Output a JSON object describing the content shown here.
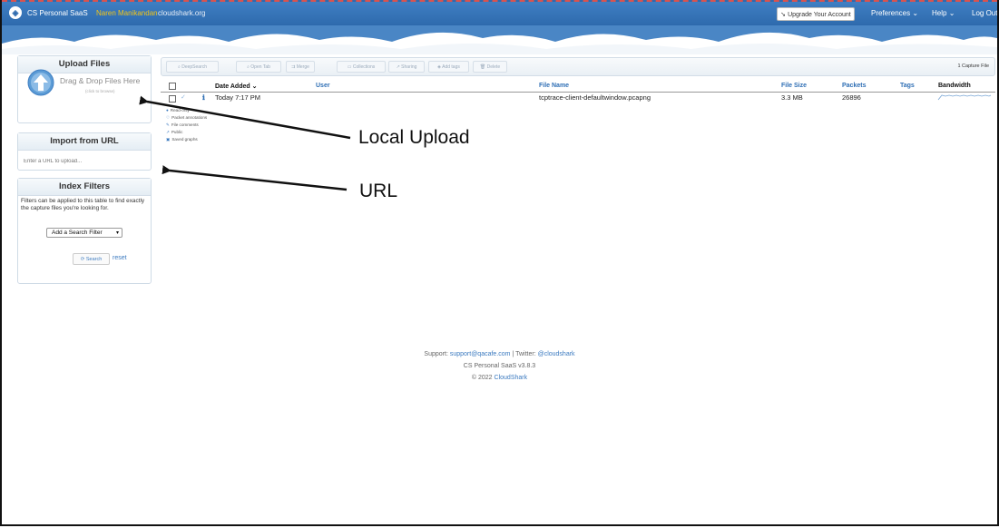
{
  "topbar": {
    "brand": "CS Personal SaaS",
    "user": "Naren Manikandan",
    "domain": "cloudshark.org",
    "upgrade": "Upgrade Your Account",
    "preferences": "Preferences",
    "help": "Help",
    "logout": "Log Out",
    "accent": "#2e6aad"
  },
  "upload": {
    "title": "Upload Files",
    "drag_text": "Drag & Drop Files Here",
    "click_hint": "(click to browse)"
  },
  "import_url": {
    "title": "Import from URL",
    "placeholder": "Enter a URL to upload..."
  },
  "filters": {
    "title": "Index Filters",
    "description": "Filters can be applied to this table to find exactly the capture files you're looking for.",
    "select_value": "Add a Search Filter",
    "search_label": "Search",
    "reset_label": "reset"
  },
  "toolbar": {
    "buttons": [
      "DeepSearch",
      "Open Tab",
      "Merge",
      "Collections",
      "Sharing",
      "Add tags",
      "Delete"
    ],
    "capture_count": "1 Capture File"
  },
  "table": {
    "headers": {
      "date_added": "Date Added",
      "user": "User",
      "file_name": "File Name",
      "file_size": "File Size",
      "packets": "Packets",
      "tags": "Tags",
      "bandwidth": "Bandwidth"
    },
    "rows": [
      {
        "date_added": "Today 7:17 PM",
        "user": "",
        "file_name": "tcptrace-client-defaultwindow.pcapng",
        "file_size": "3.3 MB",
        "packets": "26896",
        "tags": ""
      }
    ]
  },
  "legend": [
    "Read-only",
    "Packet annotations",
    "File comments",
    "Public",
    "Saved graphs"
  ],
  "annotations": {
    "local_upload": "Local Upload",
    "url": "URL"
  },
  "footer": {
    "support_prefix": "Support:",
    "support_email": "support@qacafe.com",
    "twitter_prefix": "| Twitter:",
    "twitter_handle": "@cloudshark",
    "version": "CS Personal SaaS v3.8.3",
    "copyright_prefix": "© 2022",
    "copyright_link": "CloudShark"
  }
}
